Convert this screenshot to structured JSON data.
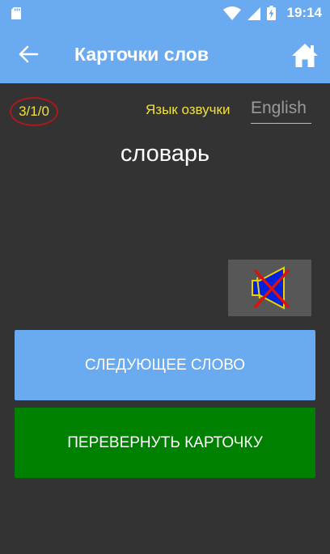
{
  "status_bar": {
    "time": "19:14",
    "icons": [
      "sd-card-icon",
      "wifi-icon",
      "signal-icon",
      "battery-charging-icon"
    ]
  },
  "app_bar": {
    "title": "Карточки слов",
    "back_icon": "arrow-left-icon",
    "home_icon": "home-icon"
  },
  "card": {
    "counter": "3/1/0",
    "voice_language_label": "Язык озвучки",
    "voice_language_value": "English",
    "word": "словарь",
    "sound_icon": "speaker-muted-icon"
  },
  "buttons": {
    "next_word": "СЛЕДУЮЩЕЕ СЛОВО",
    "flip_card": "ПЕРЕВЕРНУТЬ КАРТОЧКУ"
  },
  "colors": {
    "app_bar": "#6aaaf0",
    "background": "#333333",
    "accent_text": "#f0e040",
    "next_button": "#6aaaf0",
    "flip_button": "#008000",
    "counter_circle": "#b01818"
  }
}
